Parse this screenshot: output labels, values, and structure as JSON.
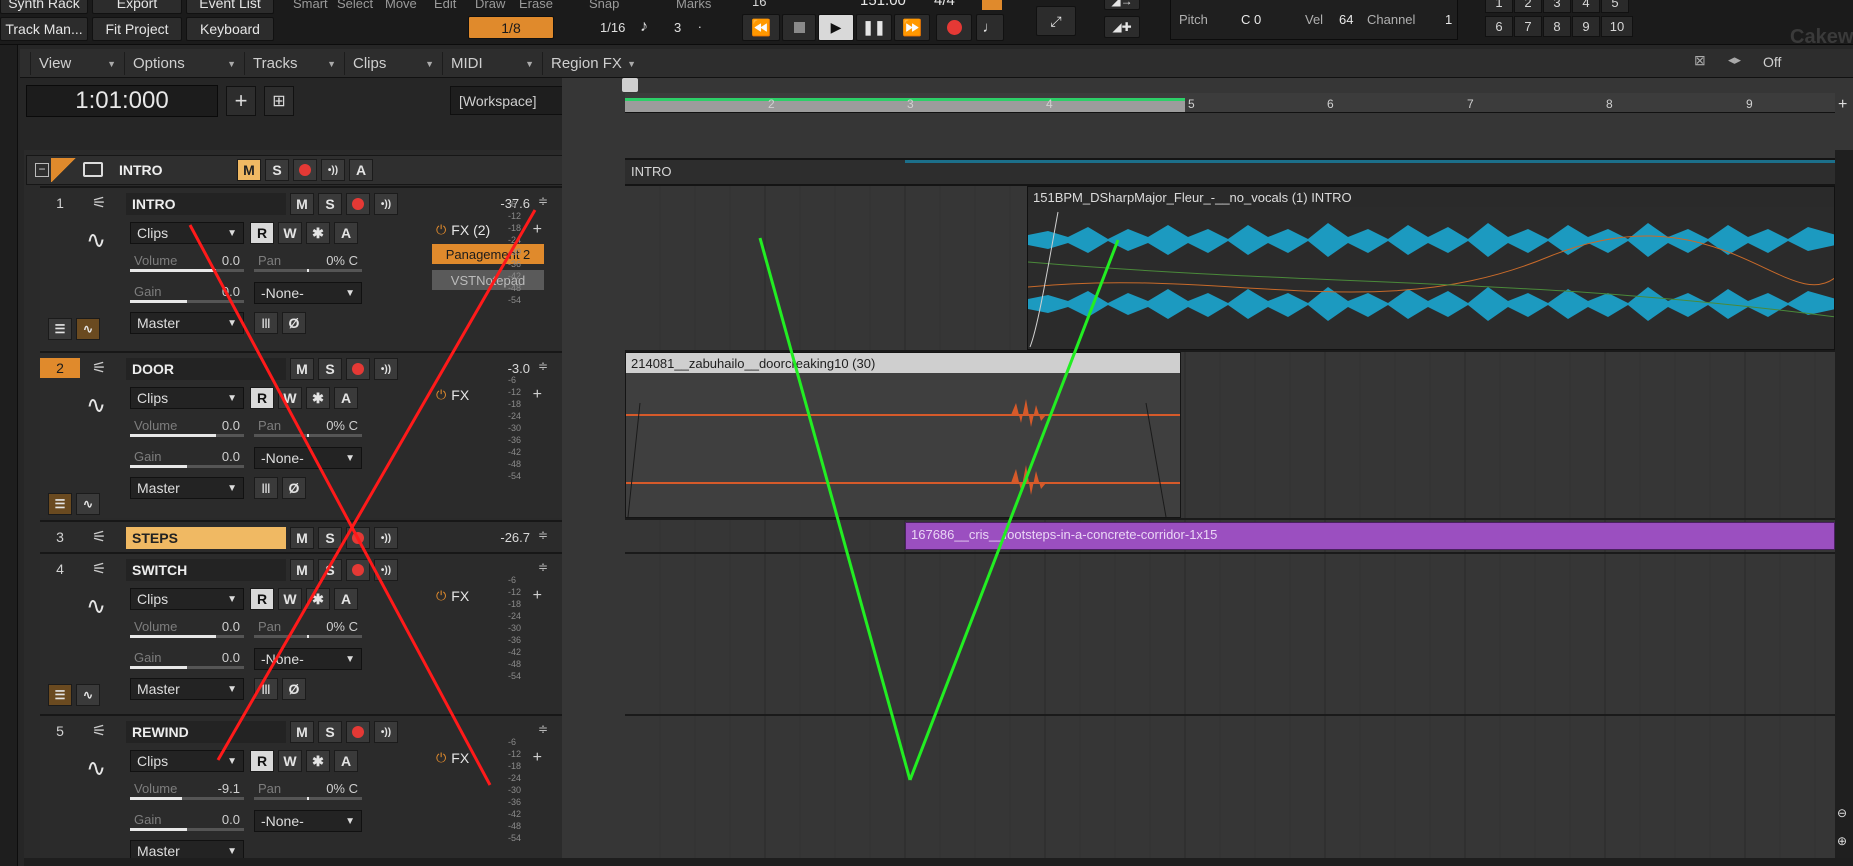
{
  "topbar": {
    "synth_rack": "Synth Rack",
    "export": "Export",
    "event_list": "Event List",
    "track_manager": "Track Man...",
    "fit_project": "Fit Project",
    "keyboard": "Keyboard",
    "tools": [
      "Smart",
      "Select",
      "Move",
      "Edit",
      "Draw",
      "Erase"
    ],
    "tool_value": "1/8",
    "snap_label": "Snap",
    "marks_label": "Marks",
    "snap_value": "1/16",
    "snap_num": "3",
    "tempo_partial": "16",
    "tempo": "151.00",
    "meter": "4/4",
    "pitch_label": "Pitch",
    "pitch_value": "C 0",
    "vel_label": "Vel",
    "vel_value": "64",
    "channel_label": "Channel",
    "channel_value": "1",
    "numbers_top": [
      "1",
      "2",
      "3",
      "4",
      "5"
    ],
    "numbers_bottom": [
      "6",
      "7",
      "8",
      "9",
      "10"
    ],
    "off_label": "Off",
    "brand_partial": "Cakew"
  },
  "menu": [
    {
      "label": "View"
    },
    {
      "label": "Options"
    },
    {
      "label": "Tracks"
    },
    {
      "label": "Clips"
    },
    {
      "label": "MIDI"
    },
    {
      "label": "Region FX"
    }
  ],
  "time_display": "1:01:000",
  "workspace": "[Workspace]",
  "folder": {
    "name": "INTRO",
    "m": "M",
    "s": "S",
    "a": "A"
  },
  "tracks": [
    {
      "num": "1",
      "name": "INTRO",
      "peak": "-37.6",
      "input": "Clips",
      "volume_label": "Volume",
      "volume": "0.0",
      "pan_label": "Pan",
      "pan": "0% C",
      "gain_label": "Gain",
      "gain": "0.0",
      "none": "-None-",
      "output": "Master",
      "fx": "FX (2)",
      "plugins": [
        "Panagement 2",
        "VSTNotepad"
      ]
    },
    {
      "num": "2",
      "name": "DOOR",
      "peak": "-3.0",
      "input": "Clips",
      "volume_label": "Volume",
      "volume": "0.0",
      "pan_label": "Pan",
      "pan": "0% C",
      "gain_label": "Gain",
      "gain": "0.0",
      "none": "-None-",
      "output": "Master",
      "fx": "FX"
    },
    {
      "num": "3",
      "name": "STEPS",
      "peak": "-26.7"
    },
    {
      "num": "4",
      "name": "SWITCH",
      "input": "Clips",
      "volume_label": "Volume",
      "volume": "0.0",
      "pan_label": "Pan",
      "pan": "0% C",
      "gain_label": "Gain",
      "gain": "0.0",
      "none": "-None-",
      "output": "Master",
      "fx": "FX"
    },
    {
      "num": "5",
      "name": "REWIND",
      "input": "Clips",
      "volume_label": "Volume",
      "volume": "-9.1",
      "pan_label": "Pan",
      "pan": "0% C",
      "gain_label": "Gain",
      "gain": "0.0",
      "none": "-None-",
      "output": "Master",
      "fx": "FX"
    }
  ],
  "buttons": {
    "m": "M",
    "s": "S",
    "r": "R",
    "w": "W",
    "a": "A"
  },
  "meter_scale": [
    "-6",
    "-12",
    "-18",
    "-24",
    "-30",
    "-36",
    "-42",
    "-48",
    "-54"
  ],
  "ruler": [
    "2",
    "3",
    "4",
    "5",
    "6",
    "7",
    "8",
    "9"
  ],
  "folder_lane_label": "INTRO",
  "clips": {
    "intro": "151BPM_DSharpMajor_Fleur_-__no_vocals (1) INTRO",
    "door": "214081__zabuhailo__doorcreaking10 (30)",
    "steps": "167686__cris__footsteps-in-a-concrete-corridor-1x15"
  },
  "colors": {
    "accent_orange": "#e08a2c",
    "wave_blue": "#1c9ac0",
    "wave_orange": "#d65a2a",
    "clip_purple": "#9b4fc0",
    "loop_green": "#2dcf68",
    "annot_red": "#ff1a1a",
    "annot_green": "#22ee22"
  }
}
